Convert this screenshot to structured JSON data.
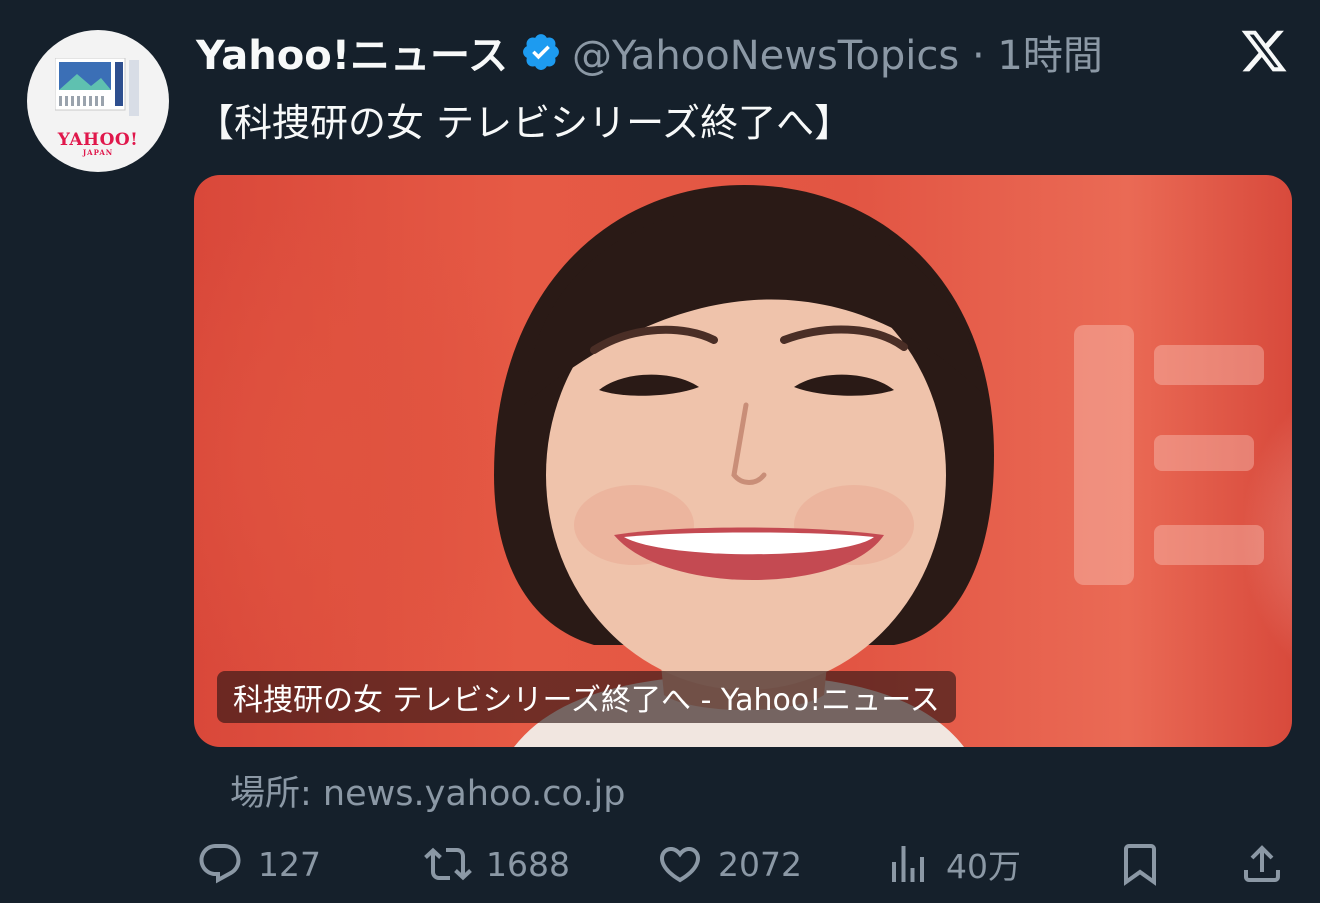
{
  "account": {
    "display_name": "Yahoo!ニュース",
    "handle_time": "@YahooNewsTopics · 1時間",
    "avatar_brand": "YAHOO!",
    "avatar_brand_sub": "JAPAN"
  },
  "tweet": {
    "text": "【科捜研の女 テレビシリーズ終了へ】"
  },
  "card": {
    "caption": "科捜研の女 テレビシリーズ終了へ - Yahoo!ニュース",
    "source": "場所: news.yahoo.co.jp"
  },
  "actions": {
    "replies": "127",
    "retweets": "1688",
    "likes": "2072",
    "views": "40万"
  },
  "icons": {
    "verified": "verified-badge-icon",
    "platform": "x-logo-icon",
    "reply": "reply-icon",
    "retweet": "retweet-icon",
    "like": "heart-icon",
    "views": "views-chart-icon",
    "bookmark": "bookmark-icon",
    "share": "share-icon"
  },
  "colors": {
    "background": "#15202b",
    "secondary_text": "#8b98a5",
    "verified": "#1d9bf0",
    "brand_red": "#e0174b"
  }
}
